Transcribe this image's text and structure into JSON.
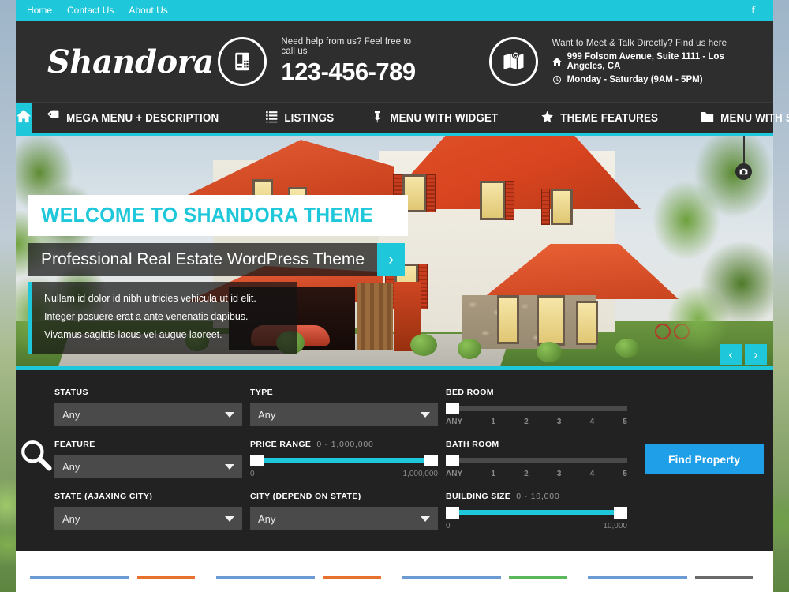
{
  "topbar": {
    "links": [
      {
        "label": "Home"
      },
      {
        "label": "Contact Us"
      },
      {
        "label": "About Us"
      }
    ],
    "social": "facebook-icon",
    "bg_color": "#1ec7d9"
  },
  "header": {
    "logo": "Shandora",
    "phone": {
      "icon": "telephone-icon",
      "caption": "Need help from us? Feel free to call us",
      "number": "123-456-789"
    },
    "address": {
      "icon": "map-icon",
      "caption": "Want to Meet & Talk Directly? Find us here",
      "street": "999 Folsom Avenue, Suite 1111 - Los Angeles, CA",
      "hours": "Monday - Saturday (9AM - 5PM)"
    },
    "bg_color": "#2e2e2e"
  },
  "nav": {
    "home_icon": "home-icon",
    "items": [
      {
        "label": "Mega Menu + Description",
        "icon": "tag-icon"
      },
      {
        "label": "Listings",
        "icon": "list-icon"
      },
      {
        "label": "Menu With Widget",
        "icon": "pin-icon"
      },
      {
        "label": "Theme Features",
        "icon": "star-icon"
      },
      {
        "label": "Menu With Sub",
        "icon": "folder-icon"
      }
    ],
    "active_color": "#1ec7d9"
  },
  "hero": {
    "title": "Welcome to Shandora Theme",
    "subtitle": "Professional Real Estate WordPress Theme",
    "description": "Nullam id dolor id nibh ultricies vehicula ut id elit. Integer posuere erat a ante venenatis dapibus. Vivamus sagittis lacus vel augue laoreet.",
    "arrow": "›",
    "prev": "‹",
    "next": "›",
    "camera_icon": "camera-icon",
    "accent_color": "#1ec7d9"
  },
  "search": {
    "icon": "magnifier-icon",
    "fields": {
      "status": {
        "label": "Status",
        "value": "Any"
      },
      "feature": {
        "label": "Feature",
        "value": "Any"
      },
      "state": {
        "label": "State (Ajaxing City)",
        "value": "Any"
      },
      "type": {
        "label": "Type",
        "value": "Any"
      },
      "city": {
        "label": "City (Depend On State)",
        "value": "Any"
      }
    },
    "price_range": {
      "label": "Price Range",
      "range_text": "0 - 1,000,000",
      "min_label": "0",
      "max_label": "1,000,000",
      "filled": true
    },
    "bed_room": {
      "label": "Bed Room",
      "ticks": [
        "ANY",
        "1",
        "2",
        "3",
        "4",
        "5"
      ],
      "filled": false
    },
    "bath_room": {
      "label": "Bath Room",
      "ticks": [
        "ANY",
        "1",
        "2",
        "3",
        "4",
        "5"
      ],
      "filled": false
    },
    "building_size": {
      "label": "Building Size",
      "range_text": "0 - 10,000",
      "min_label": "0",
      "max_label": "10,000",
      "filled": true
    },
    "submit_label": "Find Property",
    "submit_color": "#1e9fe8",
    "bg_color": "#222222"
  },
  "content_cards": [
    {
      "accent": "#e8712e"
    },
    {
      "accent": "#e8712e"
    },
    {
      "accent": "#5cb85c"
    },
    {
      "accent": "#6a6a6a"
    }
  ]
}
